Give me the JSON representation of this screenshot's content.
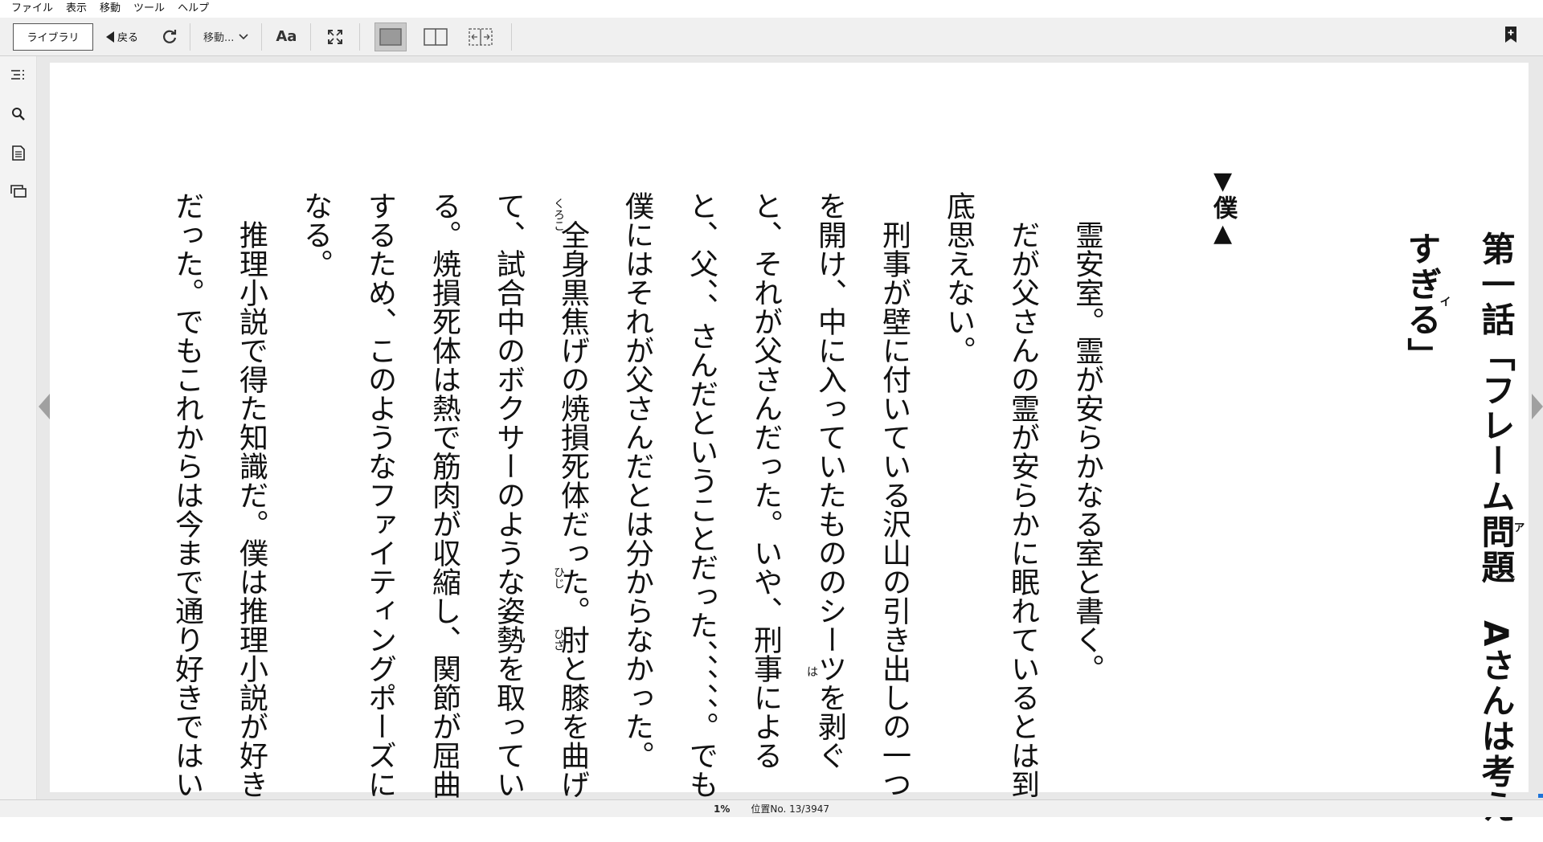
{
  "menubar": {
    "items": [
      "ファイル",
      "表示",
      "移動",
      "ツール",
      "ヘルプ"
    ]
  },
  "toolbar": {
    "library_label": "ライブラリ",
    "back_label": "戻る",
    "goto_label": "移動...",
    "font_label": "Aa",
    "active_view": "single-page"
  },
  "sidebar": {
    "icons": [
      "table-of-contents-icon",
      "search-icon",
      "notes-icon",
      "flashcards-icon"
    ]
  },
  "book": {
    "chapter_title": "第一話「フレーム問題　Aさんは考えすぎる」",
    "chapter_ruby": "アイ",
    "narrator": "▼僕▲",
    "paragraphs": [
      "霊安室。霊が安らかなる室と書く。",
      "だが父さんの霊が安らかに眠れているとは到底思えない。",
      "刑事が壁に付いている沢山の引き出しの一つを開け、中に入っていたもののシーツを剥ぐと、それが父さんだった。いや、刑事によると、父、、さんだということだった、、、、、。でも僕にはそれが父さんだとは分からなかった。",
      "全身黒焦げの焼損死体だった。肘と膝を曲げて、試合中のボクサーのような姿勢を取っている。焼損死体は熱で筋肉が収縮し、関節が屈曲するため、このようなファイティングポーズになる。",
      "推理小説で得た知識だ。僕は推理小説が好きだった。でもこれからは今まで通り好きではい"
    ],
    "ruby": {
      "hagu": "は",
      "kuroko": "くろこ",
      "hiji": "ひじ",
      "hiza": "ひざ"
    }
  },
  "status": {
    "percent": "1%",
    "location": "位置No. 13/3947"
  },
  "colors": {
    "toolbar_bg": "#f0f0f0",
    "page_bg": "#ffffff",
    "accent": "#1e73d8"
  }
}
